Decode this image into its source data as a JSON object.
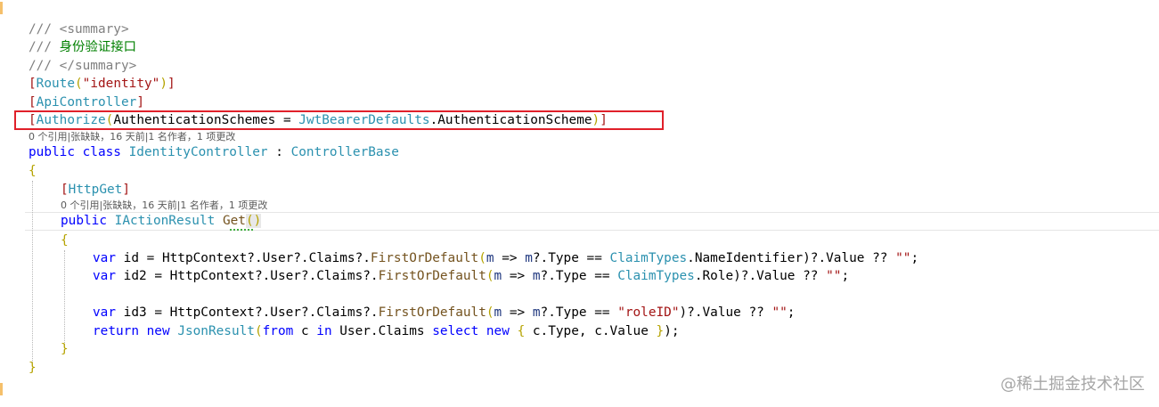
{
  "code": {
    "doc1_prefix": "/// ",
    "doc1_tag": "<summary>",
    "doc2_prefix": "/// ",
    "doc2_text": "身份验证接口",
    "doc3_prefix": "/// ",
    "doc3_tag": "</summary>",
    "route_attr": "Route",
    "route_arg": "\"identity\"",
    "apicontroller_attr": "ApiController",
    "authorize_attr": "Authorize",
    "authorize_param": "AuthenticationSchemes",
    "authorize_eq": " = ",
    "authorize_type": "JwtBearerDefaults",
    "authorize_member": ".AuthenticationScheme",
    "class_lens": "0 个引用|张缺缺，16 天前|1 名作者，1 项更改",
    "class_kw": "public class ",
    "class_name": "IdentityController",
    "class_colon": " : ",
    "class_base": "ControllerBase",
    "open_brace_class": "{",
    "httpget_attr": "HttpGet",
    "method_lens": "0 个引用|张缺缺，16 天前|1 名作者，1 项更改",
    "method_kw": "public ",
    "method_type": "IActionResult",
    "method_name": "Get",
    "method_parens": "()",
    "open_brace_method": "{",
    "line_id_a": "var",
    "line_id_b": " id = HttpContext?.User?.Claims?.",
    "line_id_c": "FirstOrDefault",
    "line_id_d": "(",
    "line_id_e": "m",
    "line_id_f": " => ",
    "line_id_g": "m",
    "line_id_h": "?.Type == ",
    "line_id_i": "ClaimTypes",
    "line_id_j": ".NameIdentifier)?.Value ?? ",
    "line_id_k": "\"\"",
    "line_id_l": ";",
    "line_id2_a": "var",
    "line_id2_b": " id2 = HttpContext?.User?.Claims?.",
    "line_id2_c": "FirstOrDefault",
    "line_id2_d": "(",
    "line_id2_e": "m",
    "line_id2_f": " => ",
    "line_id2_g": "m",
    "line_id2_h": "?.Type == ",
    "line_id2_i": "ClaimTypes",
    "line_id2_j": ".Role)?.Value ?? ",
    "line_id2_k": "\"\"",
    "line_id2_l": ";",
    "line_id3_a": "var",
    "line_id3_b": " id3 = HttpContext?.User?.Claims?.",
    "line_id3_c": "FirstOrDefault",
    "line_id3_d": "(",
    "line_id3_e": "m",
    "line_id3_f": " => ",
    "line_id3_g": "m",
    "line_id3_h": "?.Type == ",
    "line_id3_i": "\"roleID\"",
    "line_id3_j": ")?.Value ?? ",
    "line_id3_k": "\"\"",
    "line_id3_l": ";",
    "return_kw": "return",
    "return_new": " new ",
    "return_type": "JsonResult",
    "return_open": "(",
    "return_from": "from",
    "return_c1": " c ",
    "return_in": "in",
    "return_src": " User.Claims ",
    "return_select": "select",
    "return_new2": " new ",
    "return_obrace": "{",
    "return_body": " c.Type, c.Value ",
    "return_cbrace": "}",
    "return_end": ");",
    "close_brace_method": "}",
    "close_brace_class": "}"
  },
  "watermark": "@稀土掘金技术社区",
  "colors": {
    "highlight_box": "#e0202a",
    "keyword": "#0000ff",
    "type": "#2b91af",
    "string": "#a31515",
    "comment": "#008000"
  }
}
